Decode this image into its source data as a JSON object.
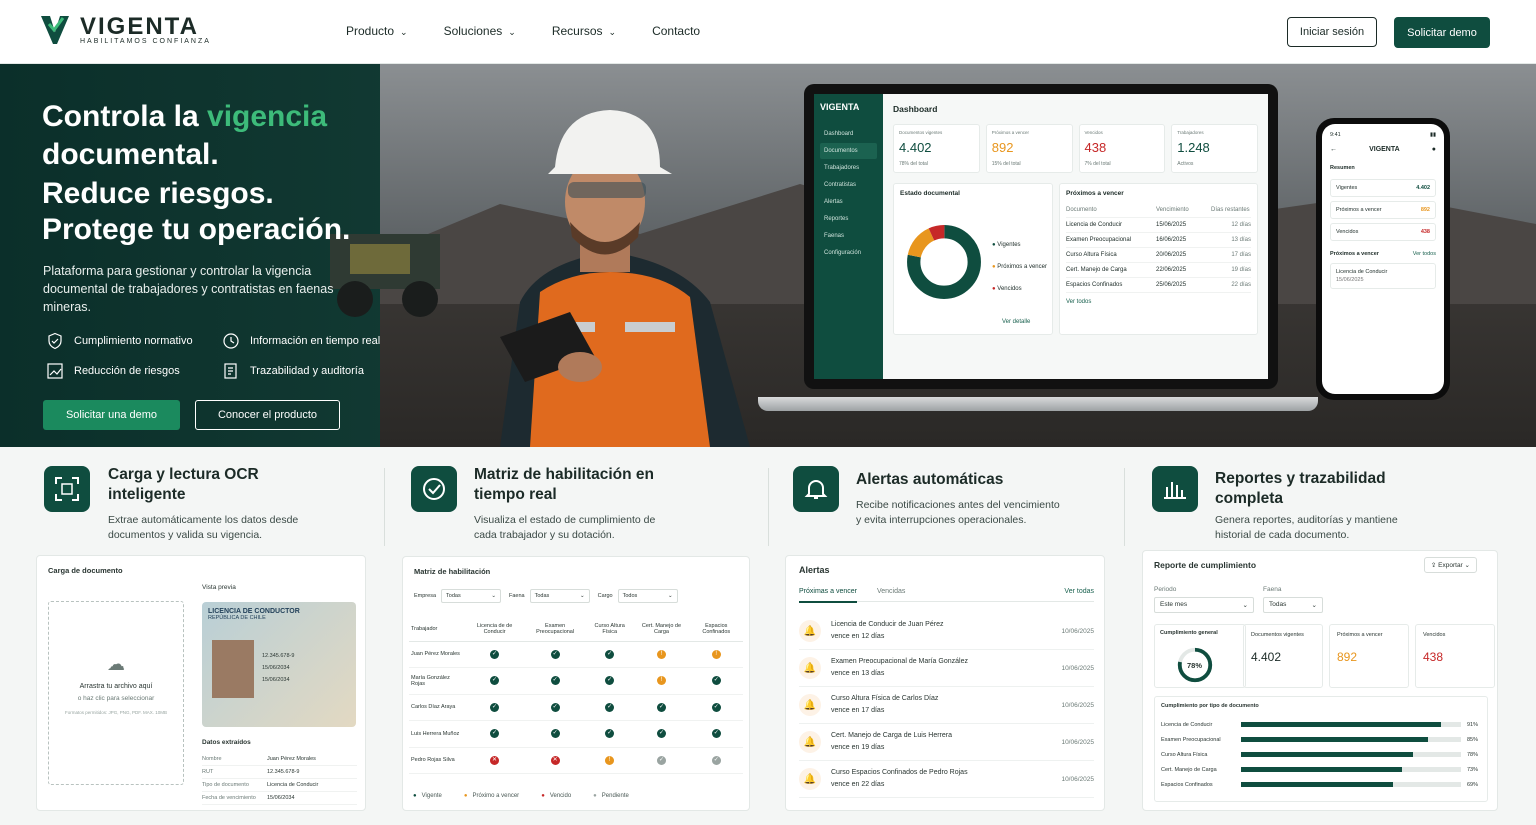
{
  "brand": {
    "name": "VIGENTA",
    "tagline": "HABILITAMOS CONFIANZA"
  },
  "nav": {
    "items": [
      "Producto",
      "Soluciones",
      "Recursos",
      "Contacto"
    ],
    "login": "Iniciar sesión",
    "demo": "Solicitar demo"
  },
  "hero": {
    "line1a": "Controla la ",
    "line1b": "vigencia",
    "line1c": "documental.",
    "line2a": "Reduce riesgos.",
    "line2b": "Protege tu operación.",
    "desc": "Plataforma para gestionar y controlar la vigencia documental de trabajadores y contratistas en faenas mineras.",
    "features": [
      "Cumplimiento normativo",
      "Información en tiempo real",
      "Reducción de riesgos",
      "Trazabilidad y auditoría"
    ],
    "cta1": "Solicitar una demo",
    "cta2": "Conocer el producto"
  },
  "dashboard": {
    "title": "Dashboard",
    "menu": [
      "Dashboard",
      "Documentos",
      "Trabajadores",
      "Contratistas",
      "Alertas",
      "Reportes",
      "Faenas",
      "Configuración"
    ],
    "cards": [
      {
        "label": "Documentos vigentes",
        "value": "4.402",
        "sub": "78% del total",
        "color": "#0f4d3f"
      },
      {
        "label": "Próximos a vencer",
        "value": "892",
        "sub": "15% del total",
        "color": "#e8961e"
      },
      {
        "label": "Vencidos",
        "value": "438",
        "sub": "7% del total",
        "color": "#c62828"
      },
      {
        "label": "Trabajadores",
        "value": "1.248",
        "sub": "Activos",
        "color": "#0f4d3f"
      }
    ],
    "estado": "Estado documental",
    "legend": [
      "Vigentes",
      "Próximos a vencer",
      "Vencidos"
    ],
    "legend_sub": [
      "",
      "",
      ""
    ],
    "ver_detalle": "Ver detalle",
    "proximos": "Próximos a vencer",
    "cols": [
      "Documento",
      "Vencimiento",
      "Días restantes"
    ],
    "rows": [
      [
        "Licencia de Conducir",
        "15/06/2025",
        "12 días"
      ],
      [
        "Examen Preocupacional",
        "16/06/2025",
        "13 días"
      ],
      [
        "Curso Altura Física",
        "20/06/2025",
        "17 días"
      ],
      [
        "Cert. Manejo de Carga",
        "22/06/2025",
        "19 días"
      ],
      [
        "Espacios Confinados",
        "25/06/2025",
        "22 días"
      ]
    ],
    "ver_todos": "Ver todos"
  },
  "phone": {
    "time": "9:41",
    "brand": "VIGENTA",
    "resumen": "Resumen",
    "items": [
      {
        "label": "Vigentes",
        "value": "4.402",
        "color": "#0f4d3f"
      },
      {
        "label": "Próximos a vencer",
        "value": "892",
        "color": "#e8961e"
      },
      {
        "label": "Vencidos",
        "value": "438",
        "color": "#c62828"
      }
    ],
    "prox": "Próximos a vencer",
    "ver": "Ver todos",
    "doc": "Licencia de Conducir",
    "date": "15/06/2025"
  },
  "features": [
    {
      "title": "Carga y lectura OCR inteligente",
      "desc": "Extrae automáticamente los datos desde documentos y valida su vigencia."
    },
    {
      "title": "Matriz de habilitación en tiempo real",
      "desc": "Visualiza el estado de cumplimiento de cada trabajador y su dotación."
    },
    {
      "title": "Alertas automáticas",
      "desc": "Recibe notificaciones antes del vencimiento y evita interrupciones operacionales."
    },
    {
      "title": "Reportes y trazabilidad completa",
      "desc": "Genera reportes, auditorías y mantiene historial de cada documento."
    }
  ],
  "ocr": {
    "title": "Carga de documento",
    "drop": "Arrastra tu archivo aquí",
    "click": "o haz clic para seleccionar",
    "formats": "Formatos permitidos: JPG, PNG, PDF. MAX. 10MB",
    "preview": "Vista previa",
    "card_t1": "LICENCIA DE CONDUCTOR",
    "card_t2": "REPÚBLICA DE CHILE",
    "card_rut": "12.345.678-9",
    "card_d1": "15/06/2034",
    "card_d2": "15/06/2034",
    "extr": "Datos extraídos",
    "fields": [
      [
        "Nombre",
        "Juan Pérez Morales"
      ],
      [
        "RUT",
        "12.345.678-9"
      ],
      [
        "Tipo de documento",
        "Licencia de Conducir"
      ],
      [
        "Fecha de vencimiento",
        "15/06/2034"
      ]
    ]
  },
  "matrix": {
    "title": "Matriz de habilitación",
    "filters": [
      [
        "Empresa",
        "Todas"
      ],
      [
        "Faena",
        "Todas"
      ],
      [
        "Cargo",
        "Todos"
      ]
    ],
    "cols": [
      "Trabajador",
      "Licencia de de Conducir",
      "Examen Preocupacional",
      "Curso Altura Física",
      "Cert. Manejo de Carga",
      "Espacios Confinados"
    ],
    "rows": [
      {
        "name": "Juan Pérez Morales",
        "s": [
          "v",
          "v",
          "v",
          "p",
          "p"
        ]
      },
      {
        "name": "María González Rojas",
        "s": [
          "v",
          "v",
          "v",
          "p",
          "v"
        ]
      },
      {
        "name": "Carlos Díaz Araya",
        "s": [
          "v",
          "v",
          "v",
          "v",
          "v"
        ]
      },
      {
        "name": "Luis Herrera Muñoz",
        "s": [
          "v",
          "v",
          "v",
          "v",
          "v"
        ]
      },
      {
        "name": "Pedro Rojas Silva",
        "s": [
          "x",
          "x",
          "p",
          "n",
          "n"
        ]
      }
    ],
    "legend": [
      "Vigente",
      "Próximo a vencer",
      "Vencido",
      "Pendiente"
    ]
  },
  "alerts": {
    "title": "Alertas",
    "tabs": [
      "Próximas a vencer",
      "Vencidas"
    ],
    "ver": "Ver todas",
    "items": [
      [
        "Licencia de Conducir de Juan Pérez",
        "vence en 12 días",
        "10/06/2025",
        "#e8961e"
      ],
      [
        "Examen Preocupacional de María González",
        "vence en 13 días",
        "10/06/2025",
        "#e8961e"
      ],
      [
        "Curso Altura Física de Carlos Díaz",
        "vence en 17 días",
        "10/06/2025",
        "#e8961e"
      ],
      [
        "Cert. Manejo de Carga de Luis Herrera",
        "vence en 19 días",
        "10/06/2025",
        "#c62828"
      ],
      [
        "Curso Espacios Confinados de Pedro Rojas",
        "vence en 22 días",
        "10/06/2025",
        "#c62828"
      ]
    ]
  },
  "report": {
    "title": "Reporte de cumplimiento",
    "export": "Exportar",
    "periodo": "Periodo",
    "periodo_v": "Este mes",
    "faena": "Faena",
    "faena_v": "Todas",
    "general": "Cumplimiento general",
    "pct": "78%",
    "cards": [
      [
        "Documentos vigentes",
        "4.402",
        "#1c2b27"
      ],
      [
        "Próximos a vencer",
        "892",
        "#e8961e"
      ],
      [
        "Vencidos",
        "438",
        "#c62828"
      ]
    ],
    "bytype": "Cumplimiento por tipo de documento",
    "bars": [
      [
        "Licencia de Conducir",
        91,
        "91%"
      ],
      [
        "Examen Preocupacional",
        85,
        "85%"
      ],
      [
        "Curso Altura Física",
        78,
        "78%"
      ],
      [
        "Cert. Manejo de Carga",
        73,
        "73%"
      ],
      [
        "Espacios Confinados",
        69,
        "69%"
      ]
    ]
  }
}
